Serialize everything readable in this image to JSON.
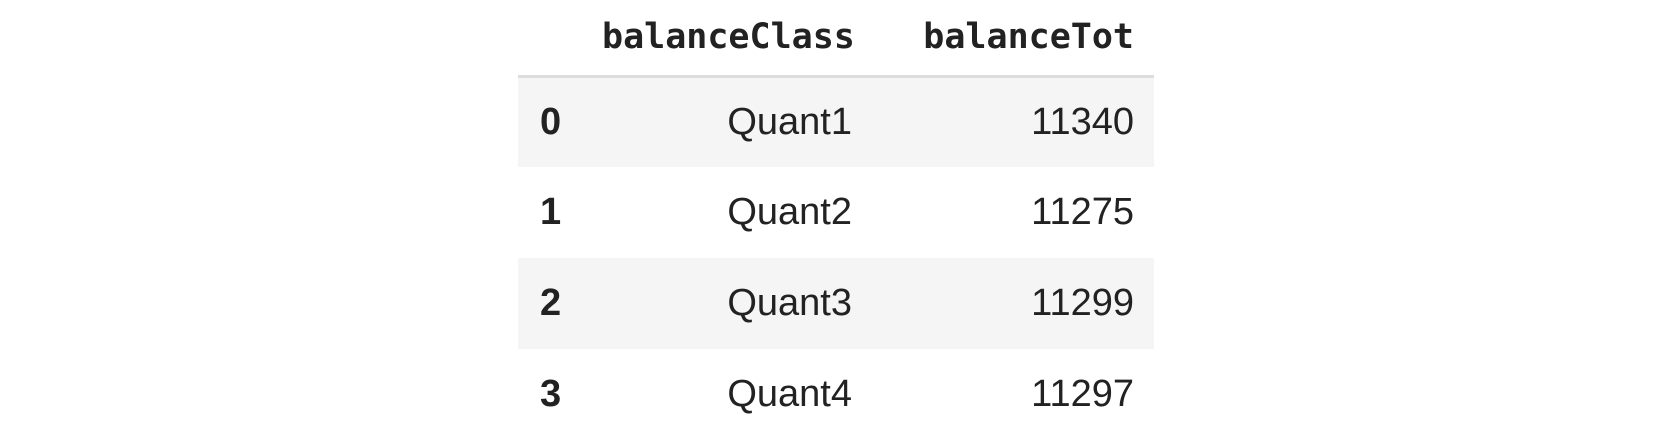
{
  "table": {
    "index_header": "",
    "columns": [
      "balanceClass",
      "balanceTot"
    ],
    "rows": [
      {
        "index": "0",
        "balanceClass": "Quant1",
        "balanceTot": "11340"
      },
      {
        "index": "1",
        "balanceClass": "Quant2",
        "balanceTot": "11275"
      },
      {
        "index": "2",
        "balanceClass": "Quant3",
        "balanceTot": "11299"
      },
      {
        "index": "3",
        "balanceClass": "Quant4",
        "balanceTot": "11297"
      }
    ]
  },
  "colors": {
    "text": "#222222",
    "stripe": "#f5f5f5",
    "header_rule": "#dddddd",
    "background": "#ffffff"
  }
}
